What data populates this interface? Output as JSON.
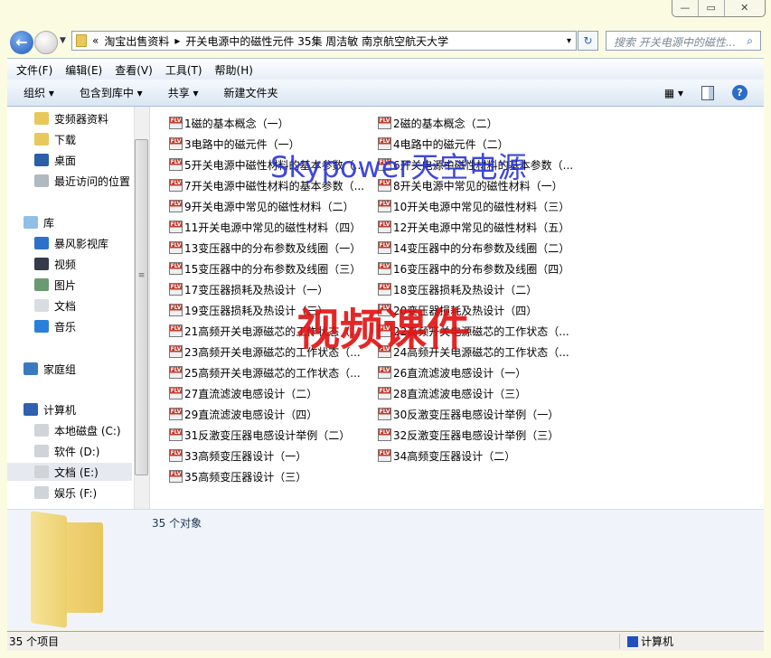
{
  "window": {
    "minimize": "—",
    "maximize": "▭",
    "close": "✕"
  },
  "address": {
    "overflow": "«",
    "crumbs": [
      "淘宝出售资料",
      "开关电源中的磁性元件 35集 周洁敏 南京航空航天大学"
    ],
    "separator": "▸",
    "dropdown": "▾",
    "refresh": "↻"
  },
  "search": {
    "placeholder": "搜索 开关电源中的磁性...",
    "icon": "search-icon"
  },
  "menu": [
    "文件(F)",
    "编辑(E)",
    "查看(V)",
    "工具(T)",
    "帮助(H)"
  ],
  "toolbar": {
    "organize": "组织 ▾",
    "include": "包含到库中 ▾",
    "share": "共享 ▾",
    "new_folder": "新建文件夹",
    "view": "▦ ▾",
    "help": "?"
  },
  "nav": {
    "favorites": [
      {
        "label": "变频器资料",
        "icon": "folder-icon",
        "color": "#e8c85a"
      },
      {
        "label": "下载",
        "icon": "download-folder-icon",
        "color": "#e8c85a"
      },
      {
        "label": "桌面",
        "icon": "desktop-icon",
        "color": "#2b5fa8"
      },
      {
        "label": "最近访问的位置",
        "icon": "recent-places-icon",
        "color": "#b0b8c0"
      }
    ],
    "libraries": {
      "label": "库",
      "items": [
        {
          "label": "暴风影视库",
          "icon": "library-icon",
          "color": "#2c72c8"
        },
        {
          "label": "视频",
          "icon": "video-icon",
          "color": "#333c48"
        },
        {
          "label": "图片",
          "icon": "pictures-icon",
          "color": "#6c9a70"
        },
        {
          "label": "文档",
          "icon": "documents-icon",
          "color": "#d8dde4"
        },
        {
          "label": "音乐",
          "icon": "music-icon",
          "color": "#2a80d8"
        }
      ]
    },
    "homegroup": "家庭组",
    "computer": {
      "label": "计算机",
      "items": [
        {
          "label": "本地磁盘 (C:)",
          "icon": "system-drive-icon"
        },
        {
          "label": "软件 (D:)",
          "icon": "drive-icon"
        },
        {
          "label": "文档 (E:)",
          "icon": "drive-icon",
          "selected": true
        },
        {
          "label": "娱乐 (F:)",
          "icon": "drive-icon"
        }
      ]
    }
  },
  "files": [
    "1磁的基本概念（一）",
    "2磁的基本概念（二）",
    "3电路中的磁元件（一）",
    "4电路中的磁元件（二）",
    "5开关电源中磁性材料的基本参数（...",
    "6开关电源中磁性材料的基本参数（...",
    "7开关电源中磁性材料的基本参数（...",
    "8开关电源中常见的磁性材料（一）",
    "9开关电源中常见的磁性材料（二）",
    "10开关电源中常见的磁性材料（三）",
    "11开关电源中常见的磁性材料（四）",
    "12开关电源中常见的磁性材料（五）",
    "13变压器中的分布参数及线圈（一）",
    "14变压器中的分布参数及线圈（二）",
    "15变压器中的分布参数及线圈（三）",
    "16变压器中的分布参数及线圈（四）",
    "17变压器损耗及热设计（一）",
    "18变压器损耗及热设计（二）",
    "19变压器损耗及热设计（三）",
    "20变压器损耗及热设计（四）",
    "21高频开关电源磁芯的工作状态（...",
    "22高频开关电源磁芯的工作状态（...",
    "23高频开关电源磁芯的工作状态（...",
    "24高频开关电源磁芯的工作状态（...",
    "25高频开关电源磁芯的工作状态（...",
    "26直流滤波电感设计（一）",
    "27直流滤波电感设计（二）",
    "28直流滤波电感设计（三）",
    "29直流滤波电感设计（四）",
    "30反激变压器电感设计举例（一）",
    "31反激变压器电感设计举例（二）",
    "32反激变压器电感设计举例（三）",
    "33高频变压器设计（一）",
    "34高频变压器设计（二）",
    "35高频变压器设计（三）"
  ],
  "file_icon_label": "FLV",
  "watermarks": {
    "top": "Skypower天空电源",
    "center": "视频课件",
    "top_color": "#2a35d8",
    "center_color": "#e01010"
  },
  "details": {
    "count": "35 个对象"
  },
  "status": {
    "items": "35 个项目",
    "location": "计算机"
  }
}
